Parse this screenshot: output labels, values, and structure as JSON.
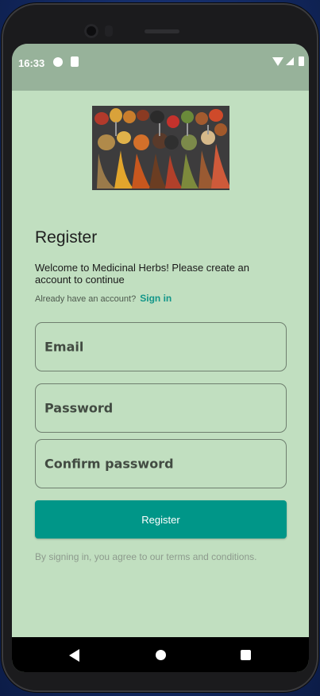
{
  "statusbar": {
    "time": "16:33",
    "icons": [
      "app-notification-icon",
      "sd-card-icon",
      "wifi-icon",
      "signal-icon",
      "battery-icon"
    ]
  },
  "hero_image": {
    "description_icon": "spices-spoons-image"
  },
  "register": {
    "title": "Register",
    "welcome": "Welcome to Medicinal Herbs! Please create an account to continue",
    "already_text": "Already have an account?",
    "signin_link": "Sign in",
    "email_placeholder": "Email",
    "password_placeholder": "Password",
    "confirm_placeholder": "Confirm password",
    "button_label": "Register",
    "terms": "By signing in, you agree to our terms and conditions."
  },
  "colors": {
    "background": "#c1dfc0",
    "statusbar": "#97b29a",
    "accent": "#009688",
    "link": "#129689"
  },
  "navbar": {
    "icons": [
      "back-icon",
      "home-icon",
      "recents-icon"
    ]
  }
}
